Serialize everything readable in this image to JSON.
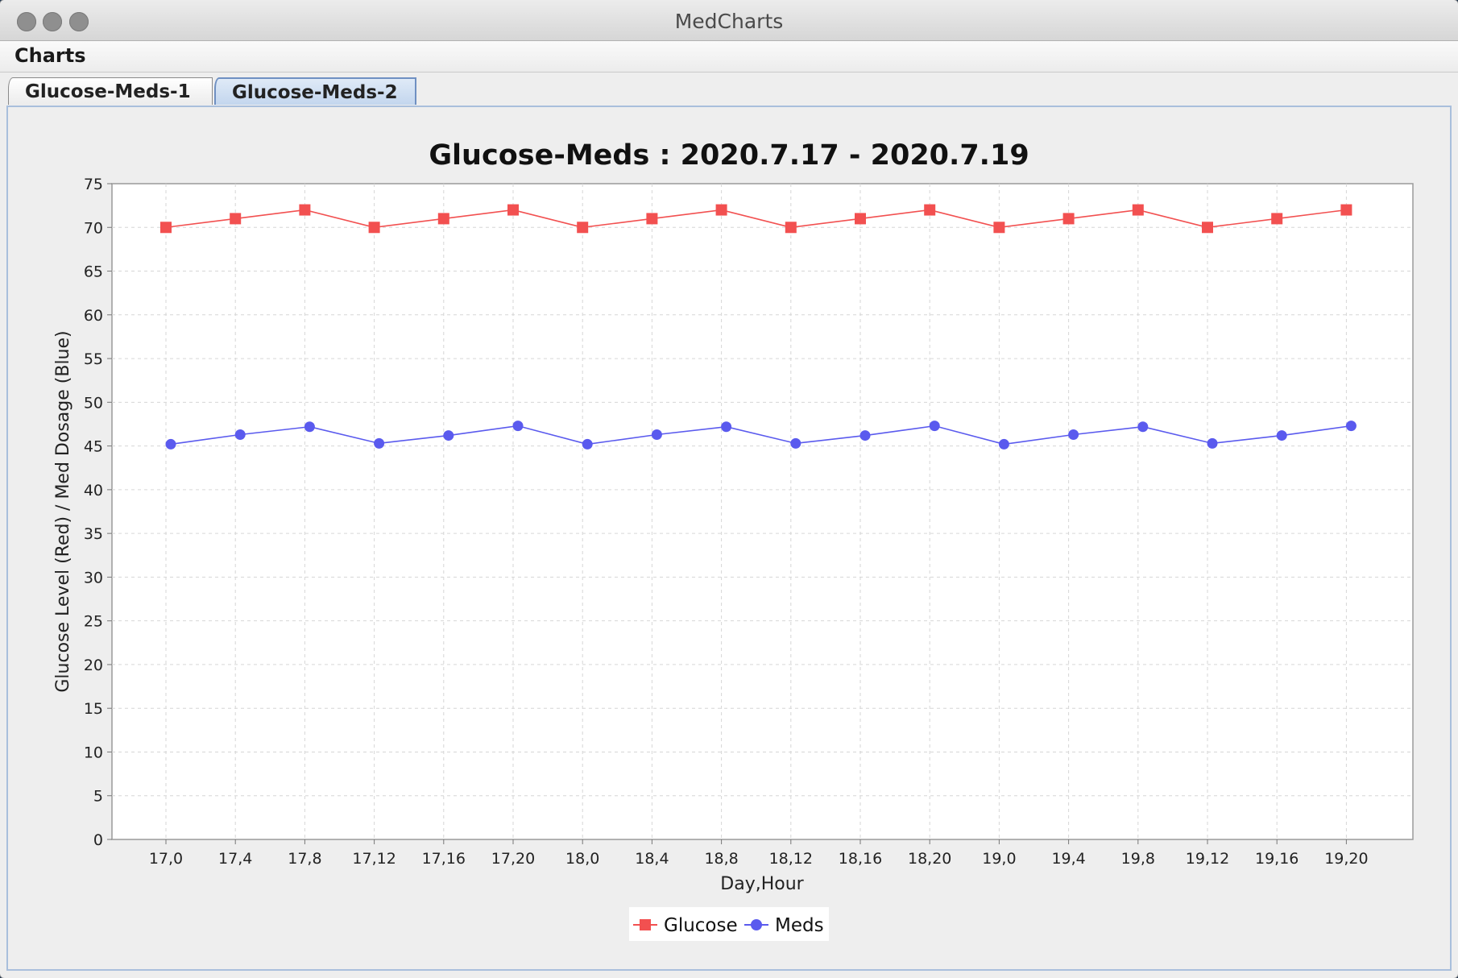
{
  "window": {
    "title": "MedCharts"
  },
  "menu": {
    "items": [
      "Charts"
    ]
  },
  "tabs": [
    {
      "label": "Glucose-Meds-1",
      "selected": false
    },
    {
      "label": "Glucose-Meds-2",
      "selected": true
    }
  ],
  "chart_data": {
    "type": "line",
    "title": "Glucose-Meds : 2020.7.17 - 2020.7.19",
    "xlabel": "Day,Hour",
    "ylabel": "Glucose Level (Red) / Med Dosage (Blue)",
    "ylim": [
      0,
      75
    ],
    "ytick_step": 5,
    "grid": true,
    "legend_position": "bottom-center",
    "categories": [
      "17,0",
      "17,4",
      "17,8",
      "17,12",
      "17,16",
      "17,20",
      "18,0",
      "18,4",
      "18,8",
      "18,12",
      "18,16",
      "18,20",
      "19,0",
      "19,4",
      "19,8",
      "19,12",
      "19,16",
      "19,20"
    ],
    "series": [
      {
        "name": "Glucose",
        "color": "#f25050",
        "marker": "square",
        "values": [
          70,
          71,
          72,
          70,
          71,
          72,
          70,
          71,
          72,
          70,
          71,
          72,
          70,
          71,
          72,
          70,
          71,
          72
        ]
      },
      {
        "name": "Meds",
        "color": "#5a5aee",
        "marker": "circle",
        "values": [
          45.2,
          46.3,
          47.2,
          45.3,
          46.2,
          47.3,
          45.2,
          46.3,
          47.2,
          45.3,
          46.2,
          47.3,
          45.2,
          46.3,
          47.2,
          45.3,
          46.2,
          47.3
        ]
      }
    ]
  }
}
